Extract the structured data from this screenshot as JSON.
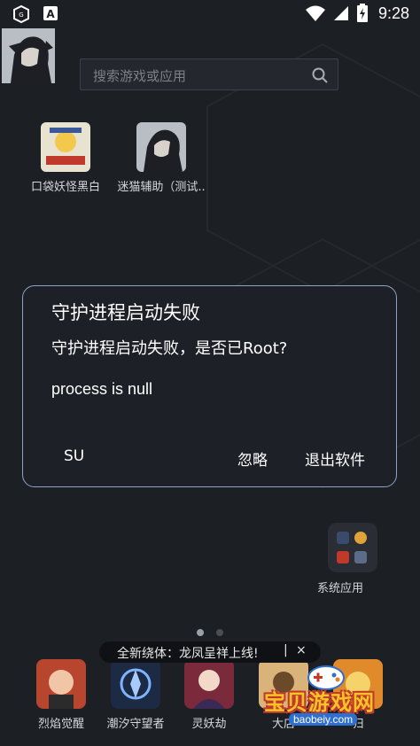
{
  "status_bar": {
    "time": "9:28",
    "icons": [
      "app-logo-icon",
      "font-icon",
      "wifi-icon",
      "signal-icon",
      "battery-charging-icon"
    ]
  },
  "search": {
    "placeholder": "搜索游戏或应用"
  },
  "apps": [
    {
      "label": "口袋妖怪黑白",
      "icon": "game-cover-icon"
    },
    {
      "label": "迷猫辅助（测试..",
      "icon": "anime-avatar-icon"
    }
  ],
  "dialog": {
    "title": "守护进程启动失败",
    "message": "守护进程启动失败，是否已Root?",
    "detail": "process is null",
    "buttons": {
      "su": "SU",
      "ignore": "忽略",
      "exit": "退出软件"
    }
  },
  "folder": {
    "label": "系统应用"
  },
  "toast": {
    "text": "全新绕体：龙凤呈祥上线!",
    "separator": "|",
    "close": "×"
  },
  "dock": [
    {
      "label": "烈焰觉醒"
    },
    {
      "label": "潮汐守望者"
    },
    {
      "label": "灵妖劫"
    },
    {
      "label": "大店"
    },
    {
      "label": "归"
    }
  ],
  "watermark": {
    "text": "宝贝游戏网",
    "url": "baobeiy.com"
  },
  "colors": {
    "background": "#1c1f24",
    "dialog_border": "#8fa3c8",
    "watermark": "#f7c326"
  }
}
